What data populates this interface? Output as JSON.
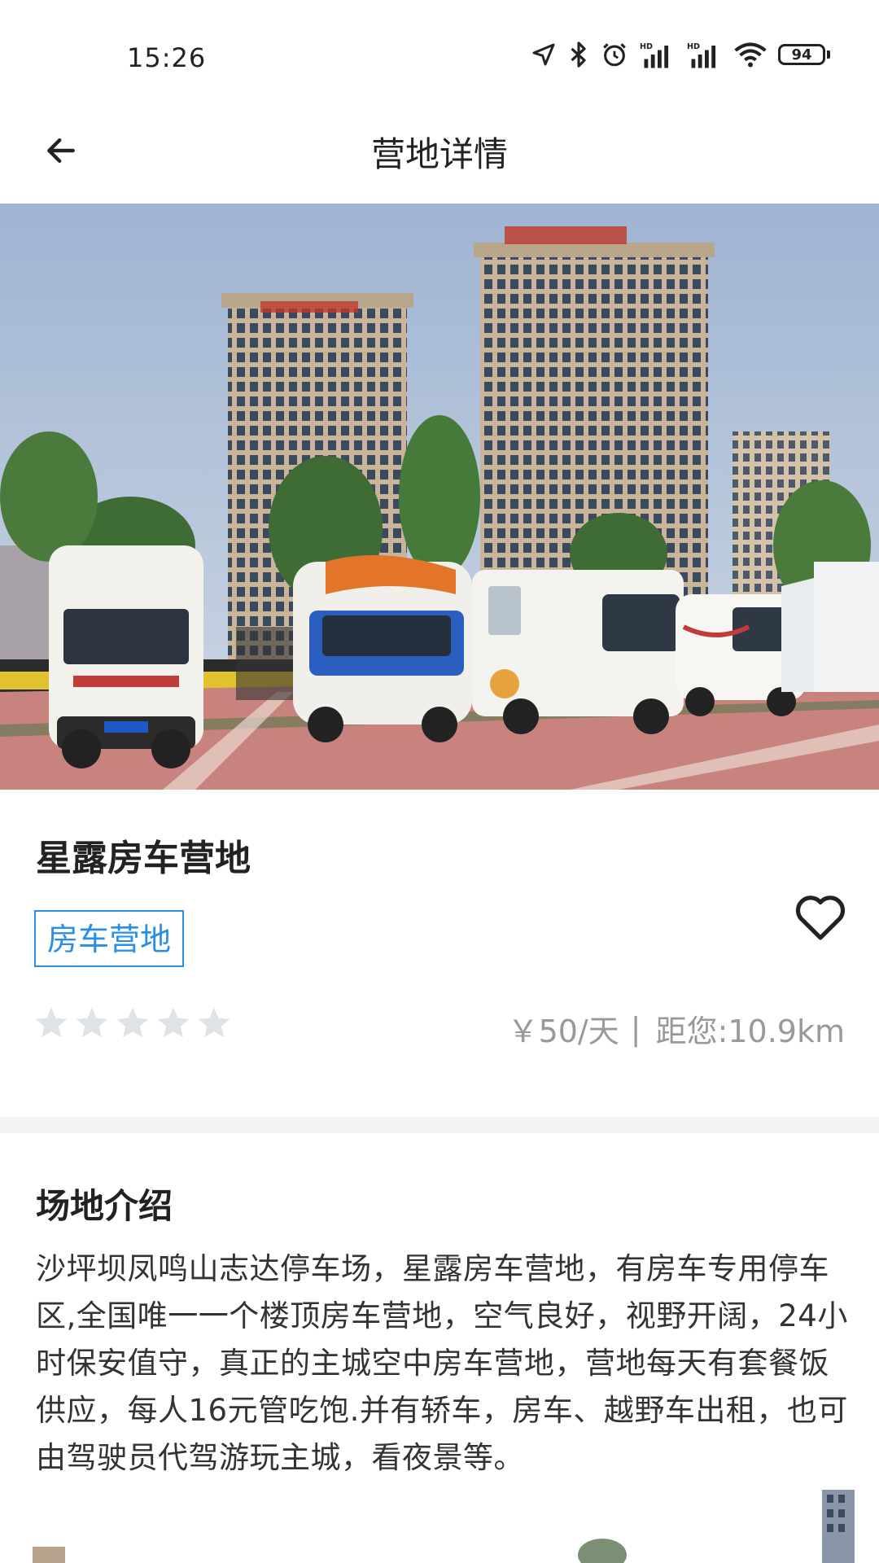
{
  "status_bar": {
    "time": "15:26",
    "battery": "94",
    "icons": [
      "location-icon",
      "bluetooth-icon",
      "alarm-icon",
      "signal-hd-icon",
      "signal-hd-icon",
      "wifi-icon",
      "battery-icon"
    ]
  },
  "header": {
    "title": "营地详情",
    "back_icon": "arrow-left-icon"
  },
  "camp": {
    "name": "星露房车营地",
    "tag": "房车营地",
    "rating": 0,
    "rating_max": 5,
    "price": "￥50/天",
    "separator": "|",
    "distance": "距您:10.9km",
    "favorite_icon": "heart-outline-icon"
  },
  "intro": {
    "title": "场地介绍",
    "body": "沙坪坝凤鸣山志达停车场，星露房车营地，有房车专用停车区,全国唯一一个楼顶房车营地，空气良好，视野开阔，24小时保安值守，真正的主城空中房车营地，营地每天有套餐饭供应，每人16元管吃饱.并有轿车，房车、越野车出租，也可由驾驶员代驾游玩主城，看夜景等。"
  },
  "colors": {
    "accent": "#2a8ee8",
    "star_inactive": "#dfe3e8",
    "muted_text": "#999999",
    "band": "#f2f2f2"
  }
}
